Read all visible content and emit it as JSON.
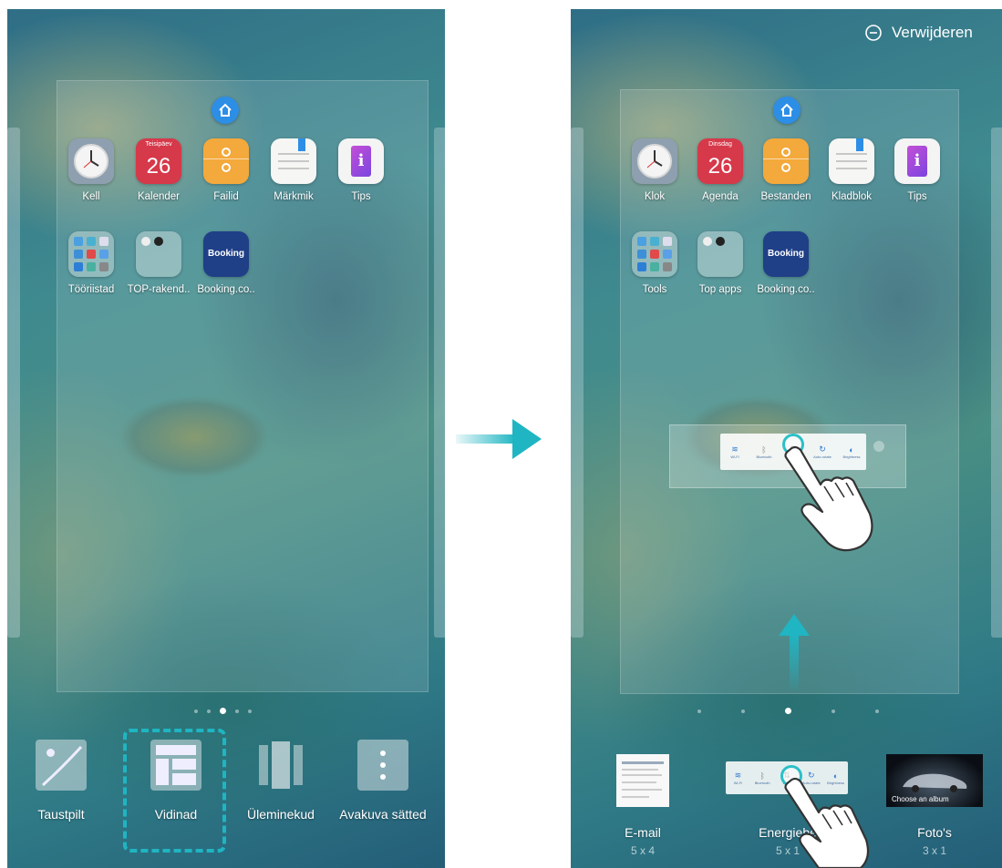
{
  "left_screen": {
    "apps_row1": [
      {
        "label": "Kell",
        "icon": "clock-icon"
      },
      {
        "label": "Kalender",
        "icon": "calendar-icon",
        "weekday": "Teisipäev",
        "day": "26"
      },
      {
        "label": "Failid",
        "icon": "files-icon"
      },
      {
        "label": "Märkmik",
        "icon": "notepad-icon"
      },
      {
        "label": "Tips",
        "icon": "tips-icon"
      }
    ],
    "apps_row2": [
      {
        "label": "Tööriistad",
        "icon": "folder-icon"
      },
      {
        "label": "TOP-rakend..",
        "icon": "folder-icon"
      },
      {
        "label": "Booking.co..",
        "icon": "booking-icon",
        "logo_text": "Booking"
      }
    ],
    "page_count": 5,
    "active_page": 2,
    "options": [
      {
        "label": "Taustpilt",
        "icon": "wallpaper-icon"
      },
      {
        "label": "Vidinad",
        "icon": "widgets-icon",
        "highlighted": true
      },
      {
        "label": "Üleminekud",
        "icon": "transitions-icon"
      },
      {
        "label": "Avakuva sätted",
        "icon": "settings-icon"
      }
    ]
  },
  "right_screen": {
    "remove_label": "Verwijderen",
    "apps_row1": [
      {
        "label": "Klok",
        "icon": "clock-icon"
      },
      {
        "label": "Agenda",
        "icon": "calendar-icon",
        "weekday": "Dinsdag",
        "day": "26"
      },
      {
        "label": "Bestanden",
        "icon": "files-icon"
      },
      {
        "label": "Kladblok",
        "icon": "notepad-icon"
      },
      {
        "label": "Tips",
        "icon": "tips-icon"
      }
    ],
    "apps_row2": [
      {
        "label": "Tools",
        "icon": "folder-icon"
      },
      {
        "label": "Top apps",
        "icon": "folder-icon"
      },
      {
        "label": "Booking.co..",
        "icon": "booking-icon",
        "logo_text": "Booking"
      }
    ],
    "page_count": 5,
    "active_page": 2,
    "dragged_widget_items": [
      "Wi-Fi",
      "Bluetooth",
      "Data",
      "Auto-rotate",
      "Brightness"
    ],
    "widgets": [
      {
        "label": "E-mail",
        "size": "5 x 4"
      },
      {
        "label": "Energiebe",
        "size": "5 x 1"
      },
      {
        "label": "Foto's",
        "size": "3 x 1",
        "thumbnail_text": "Choose an album"
      }
    ]
  },
  "colors": {
    "accent": "#1fb5c2",
    "home_badge": "#2d8ee6",
    "calendar_red": "#d6394a",
    "files_orange": "#f3a93b",
    "booking_blue": "#1f3f87"
  }
}
